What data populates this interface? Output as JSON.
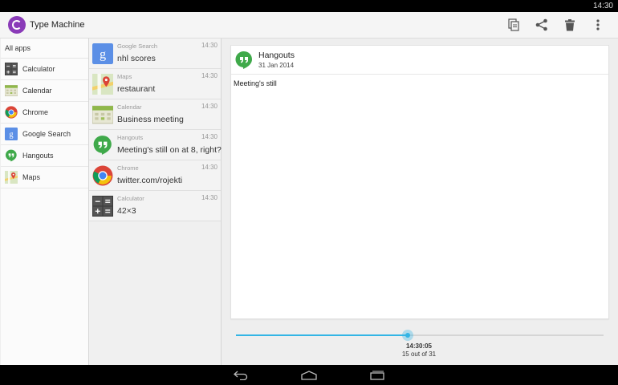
{
  "status": {
    "time": "14:30"
  },
  "app": {
    "title": "Type Machine"
  },
  "actions": [
    {
      "name": "copy-icon"
    },
    {
      "name": "share-icon"
    },
    {
      "name": "delete-icon"
    },
    {
      "name": "overflow-menu-icon"
    }
  ],
  "apps": {
    "header": "All apps",
    "items": [
      {
        "label": "Calculator",
        "icon": "calculator-icon"
      },
      {
        "label": "Calendar",
        "icon": "calendar-icon"
      },
      {
        "label": "Chrome",
        "icon": "chrome-icon"
      },
      {
        "label": "Google Search",
        "icon": "google-search-icon"
      },
      {
        "label": "Hangouts",
        "icon": "hangouts-icon"
      },
      {
        "label": "Maps",
        "icon": "maps-icon"
      }
    ]
  },
  "history": [
    {
      "app": "Google Search",
      "text": "nhl scores",
      "time": "14:30",
      "icon": "google-search-icon"
    },
    {
      "app": "Maps",
      "text": "restaurant",
      "time": "14:30",
      "icon": "maps-icon"
    },
    {
      "app": "Calendar",
      "text": "Business meeting",
      "time": "14:30",
      "icon": "calendar-icon"
    },
    {
      "app": "Hangouts",
      "text": "Meeting's still on at 8, right?",
      "time": "14:30",
      "icon": "hangouts-icon"
    },
    {
      "app": "Chrome",
      "text": "twitter.com/rojekti",
      "time": "14:30",
      "icon": "chrome-icon"
    },
    {
      "app": "Calculator",
      "text": "42×3",
      "time": "14:30",
      "icon": "calculator-icon"
    }
  ],
  "detail": {
    "app": "Hangouts",
    "date": "31 Jan 2014",
    "body": "Meeting's still",
    "icon": "hangouts-icon"
  },
  "slider": {
    "time": "14:30:05",
    "count_text": "15 out of 31",
    "position": 15,
    "total": 31
  },
  "colors": {
    "accent": "#33b5e5",
    "logo": "#8a3bb8"
  }
}
